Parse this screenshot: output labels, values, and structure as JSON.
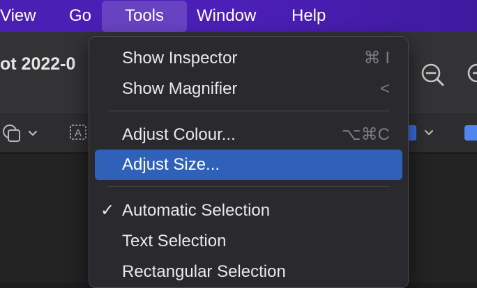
{
  "menubar": {
    "items": [
      {
        "label": "View"
      },
      {
        "label": "Go"
      },
      {
        "label": "Tools",
        "active": true
      },
      {
        "label": "Window"
      },
      {
        "label": "Help"
      }
    ]
  },
  "window": {
    "title": "ot 2022-0",
    "text_box_icon_letter": "A"
  },
  "menu": {
    "items": [
      {
        "label": "Show Inspector",
        "shortcut": "⌘ I"
      },
      {
        "label": "Show Magnifier",
        "shortcut": "<"
      },
      {
        "label": "Adjust Colour...",
        "shortcut": "⌥⌘C"
      },
      {
        "label": "Adjust Size...",
        "shortcut": "",
        "highlighted": true
      },
      {
        "label": "Automatic Selection",
        "shortcut": "",
        "checked": true,
        "check": "✓"
      },
      {
        "label": "Text Selection",
        "shortcut": ""
      },
      {
        "label": "Rectangular Selection",
        "shortcut": ""
      }
    ]
  },
  "colors": {
    "menubar": "#4a1fb4",
    "menu_background": "#2a292e",
    "highlight": "#2f61b8"
  }
}
